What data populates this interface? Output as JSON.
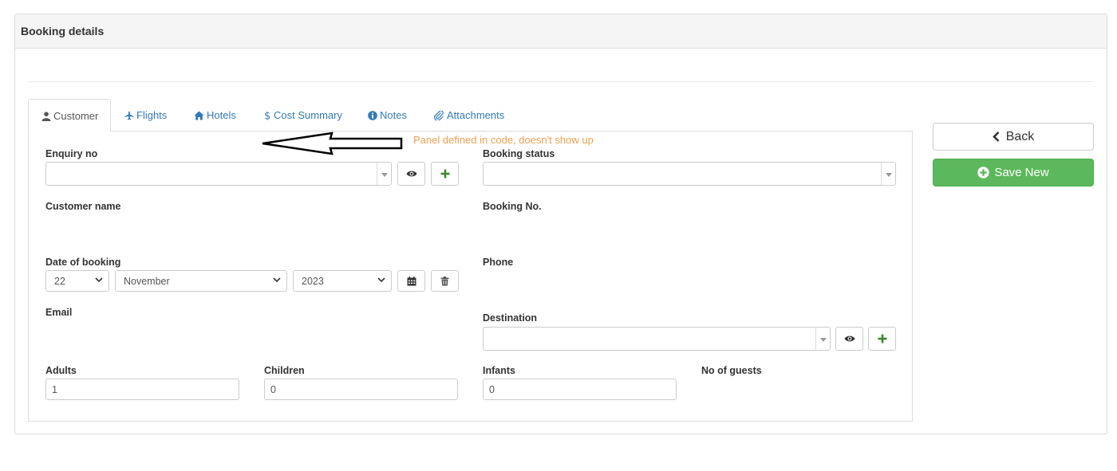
{
  "panel": {
    "title": "Booking details"
  },
  "tabs": [
    {
      "label": "Customer",
      "icon": "user-icon",
      "active": true
    },
    {
      "label": "Flights",
      "icon": "plane-icon"
    },
    {
      "label": "Hotels",
      "icon": "home-icon"
    },
    {
      "label": "Cost Summary",
      "icon": "dollar-icon"
    },
    {
      "label": "Notes",
      "icon": "info-icon"
    },
    {
      "label": "Attachments",
      "icon": "paperclip-icon"
    }
  ],
  "annotation": {
    "text": "Panel defined in code, doesn't show up",
    "color": "#f0a050"
  },
  "form": {
    "enquiry_no": {
      "label": "Enquiry no",
      "value": ""
    },
    "booking_status": {
      "label": "Booking status",
      "value": ""
    },
    "customer_name": {
      "label": "Customer name"
    },
    "booking_no": {
      "label": "Booking No."
    },
    "date_of_booking": {
      "label": "Date of booking",
      "day": "22",
      "month": "November",
      "year": "2023"
    },
    "phone": {
      "label": "Phone"
    },
    "email": {
      "label": "Email"
    },
    "destination": {
      "label": "Destination",
      "value": ""
    },
    "adults": {
      "label": "Adults",
      "value": "1"
    },
    "children": {
      "label": "Children",
      "value": "0"
    },
    "infants": {
      "label": "Infants",
      "value": "0"
    },
    "no_of_guests": {
      "label": "No of guests"
    }
  },
  "actions": {
    "back_label": "Back",
    "save_label": "Save New",
    "save_color": "#5cb85c"
  }
}
